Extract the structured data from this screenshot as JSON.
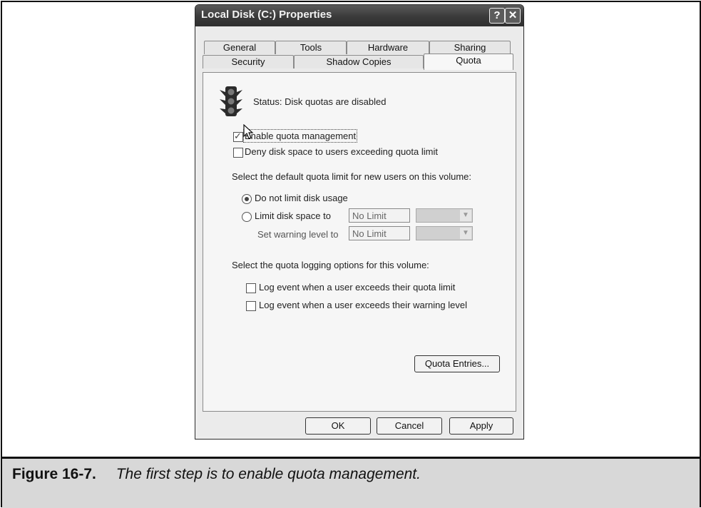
{
  "window": {
    "title": "Local Disk (C:) Properties",
    "help_glyph": "?",
    "close_glyph": "✕"
  },
  "tabs": {
    "row1": [
      "General",
      "Tools",
      "Hardware",
      "Sharing"
    ],
    "row2": [
      "Security",
      "Shadow Copies",
      "Quota"
    ],
    "active": "Quota"
  },
  "quota": {
    "status": "Status:  Disk quotas are disabled",
    "enable_quota": {
      "label": "Enable quota management",
      "checked": true
    },
    "deny_space": {
      "label": "Deny disk space to users exceeding quota limit",
      "checked": false
    },
    "default_limit_label": "Select the default quota limit for new users on this volume:",
    "no_limit_radio": {
      "label": "Do not limit disk usage",
      "selected": true
    },
    "limit_radio": {
      "label": "Limit disk space to",
      "selected": false,
      "value": "No Limit"
    },
    "warning": {
      "label": "Set warning level to",
      "value": "No Limit"
    },
    "logging_label": "Select the quota logging options for this volume:",
    "log_limit": {
      "label": "Log event when a user exceeds their quota limit",
      "checked": false
    },
    "log_warning": {
      "label": "Log event when a user exceeds their warning level",
      "checked": false
    },
    "entries_button": "Quota Entries..."
  },
  "buttons": {
    "ok": "OK",
    "cancel": "Cancel",
    "apply": "Apply"
  },
  "caption": {
    "label": "Figure 16-7.",
    "text": "The first step is to enable quota management."
  }
}
